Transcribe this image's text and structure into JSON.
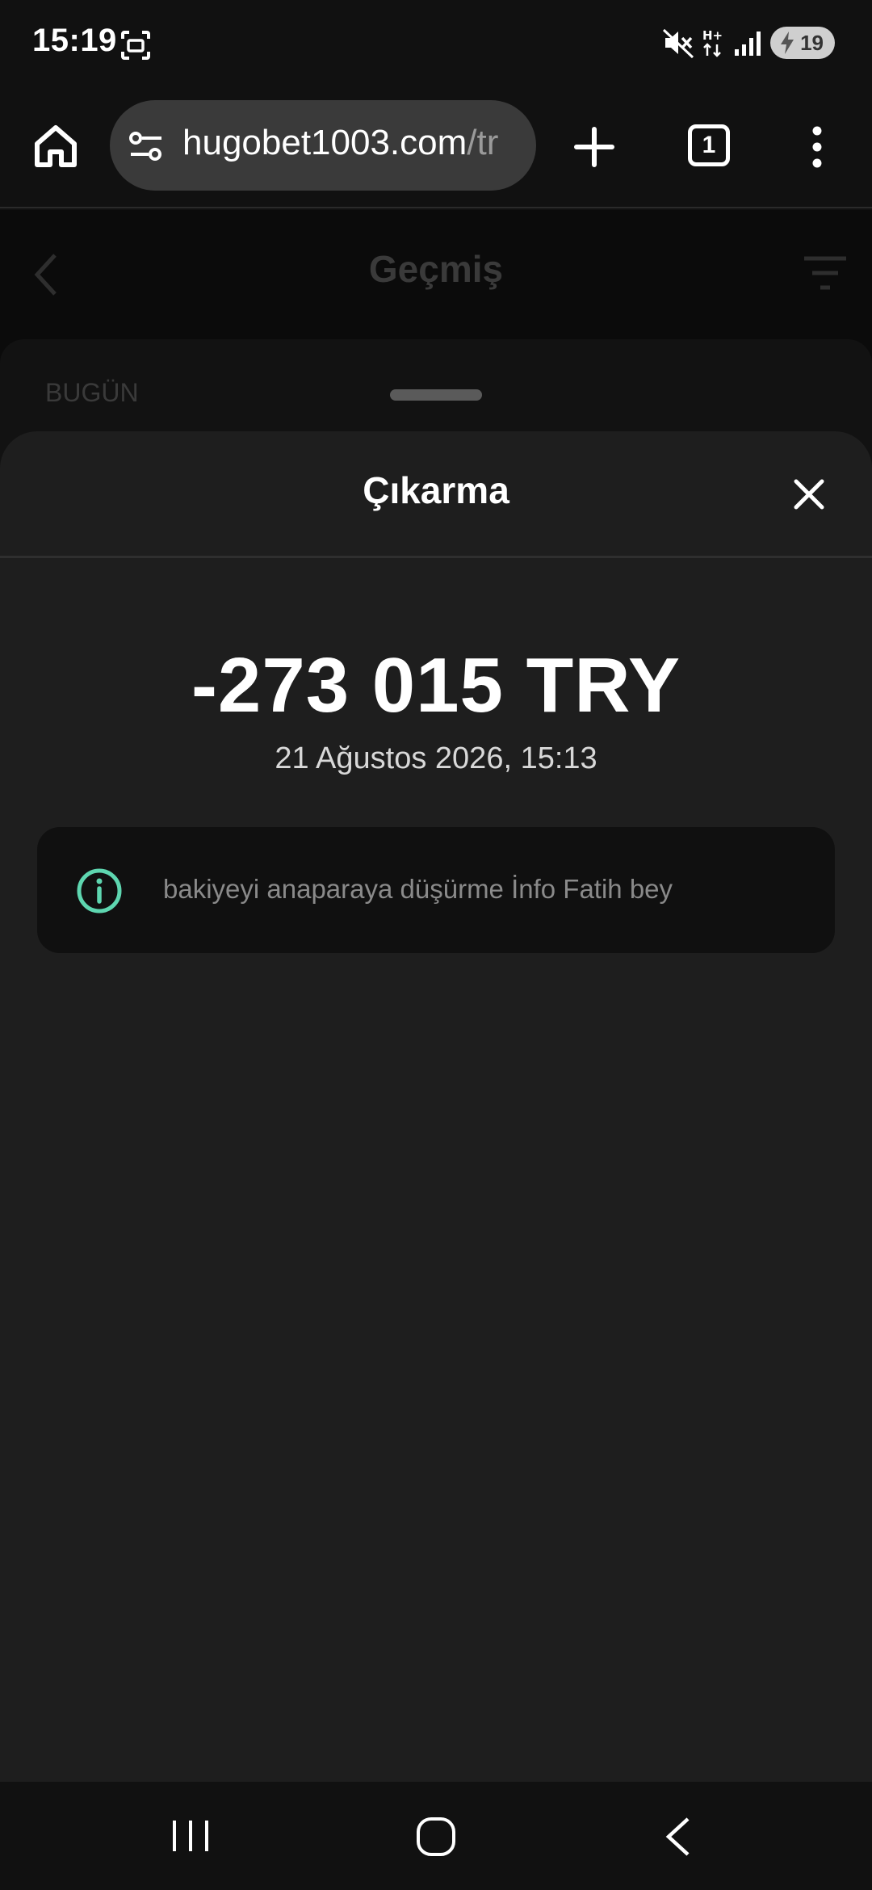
{
  "status_bar": {
    "time": "15:19",
    "battery_level": "19",
    "icons": [
      "screenshot-icon",
      "mute-icon",
      "hplus-network-icon",
      "signal-icon",
      "battery-charging-icon"
    ]
  },
  "browser": {
    "url_main": "hugobet1003.com",
    "url_dim": "/tr",
    "tab_count": "1",
    "icons": [
      "home-icon",
      "site-settings-icon",
      "plus-icon",
      "tabs-icon",
      "more-vert-icon"
    ]
  },
  "background_page": {
    "title": "Geçmiş",
    "section_label": "BUGÜN",
    "icons": [
      "chevron-left-icon",
      "filter-icon"
    ]
  },
  "sheet": {
    "title": "Çıkarma",
    "amount": "-273 015 TRY",
    "datetime": "21 Ağustos 2026, 15:13",
    "note": "bakiyeyi anaparaya düşürme İnfo Fatih bey",
    "icons": [
      "close-icon",
      "info-icon"
    ]
  },
  "nav_bar": {
    "icons": [
      "recent-apps-icon",
      "home-icon",
      "back-icon"
    ]
  },
  "colors": {
    "background": "#111111",
    "sheet": "#1e1e1e",
    "note_box": "#101010",
    "info_accent": "#5ed6b0",
    "url_box": "#3a3a3a"
  }
}
